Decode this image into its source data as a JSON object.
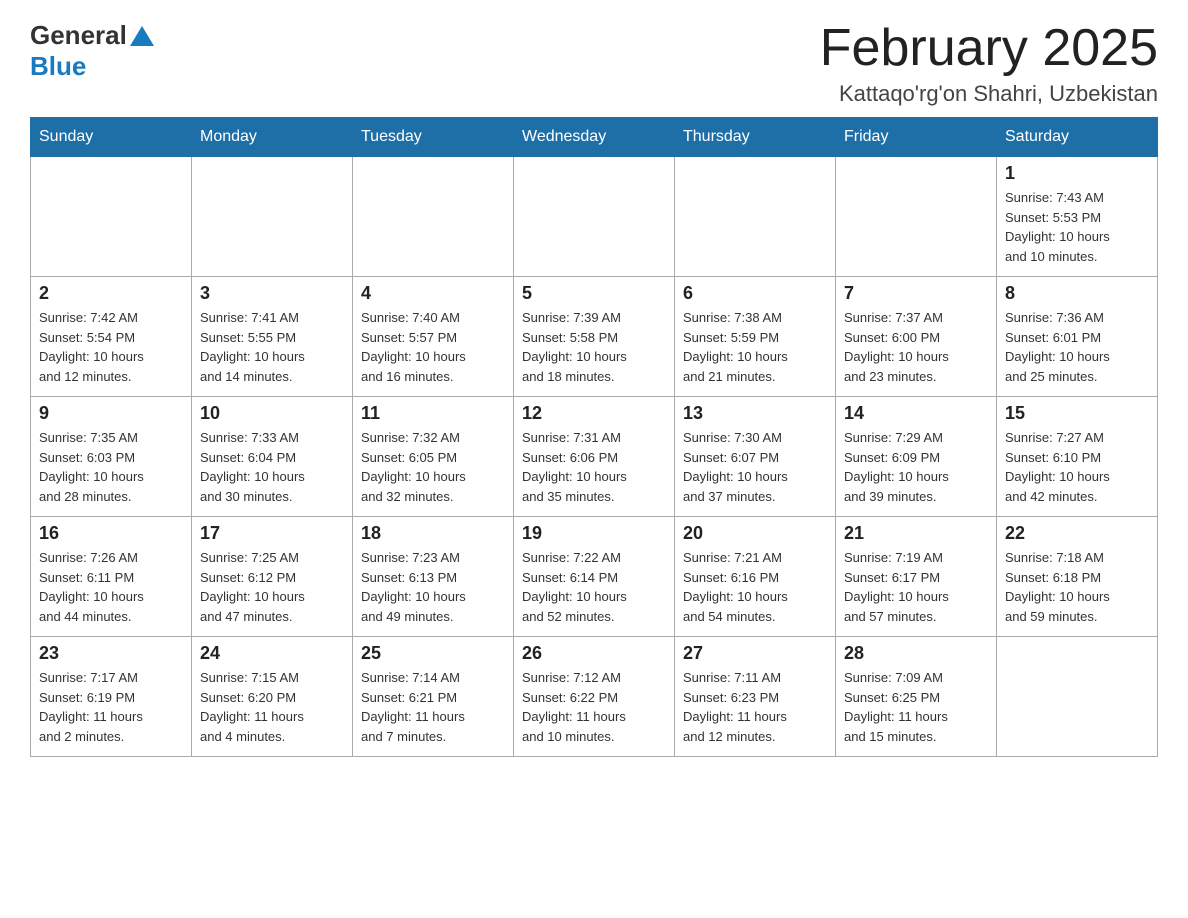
{
  "header": {
    "logo_general": "General",
    "logo_blue": "Blue",
    "month_title": "February 2025",
    "location": "Kattaqo'rg'on Shahri, Uzbekistan"
  },
  "weekdays": [
    "Sunday",
    "Monday",
    "Tuesday",
    "Wednesday",
    "Thursday",
    "Friday",
    "Saturday"
  ],
  "weeks": [
    [
      {
        "day": "",
        "info": ""
      },
      {
        "day": "",
        "info": ""
      },
      {
        "day": "",
        "info": ""
      },
      {
        "day": "",
        "info": ""
      },
      {
        "day": "",
        "info": ""
      },
      {
        "day": "",
        "info": ""
      },
      {
        "day": "1",
        "info": "Sunrise: 7:43 AM\nSunset: 5:53 PM\nDaylight: 10 hours\nand 10 minutes."
      }
    ],
    [
      {
        "day": "2",
        "info": "Sunrise: 7:42 AM\nSunset: 5:54 PM\nDaylight: 10 hours\nand 12 minutes."
      },
      {
        "day": "3",
        "info": "Sunrise: 7:41 AM\nSunset: 5:55 PM\nDaylight: 10 hours\nand 14 minutes."
      },
      {
        "day": "4",
        "info": "Sunrise: 7:40 AM\nSunset: 5:57 PM\nDaylight: 10 hours\nand 16 minutes."
      },
      {
        "day": "5",
        "info": "Sunrise: 7:39 AM\nSunset: 5:58 PM\nDaylight: 10 hours\nand 18 minutes."
      },
      {
        "day": "6",
        "info": "Sunrise: 7:38 AM\nSunset: 5:59 PM\nDaylight: 10 hours\nand 21 minutes."
      },
      {
        "day": "7",
        "info": "Sunrise: 7:37 AM\nSunset: 6:00 PM\nDaylight: 10 hours\nand 23 minutes."
      },
      {
        "day": "8",
        "info": "Sunrise: 7:36 AM\nSunset: 6:01 PM\nDaylight: 10 hours\nand 25 minutes."
      }
    ],
    [
      {
        "day": "9",
        "info": "Sunrise: 7:35 AM\nSunset: 6:03 PM\nDaylight: 10 hours\nand 28 minutes."
      },
      {
        "day": "10",
        "info": "Sunrise: 7:33 AM\nSunset: 6:04 PM\nDaylight: 10 hours\nand 30 minutes."
      },
      {
        "day": "11",
        "info": "Sunrise: 7:32 AM\nSunset: 6:05 PM\nDaylight: 10 hours\nand 32 minutes."
      },
      {
        "day": "12",
        "info": "Sunrise: 7:31 AM\nSunset: 6:06 PM\nDaylight: 10 hours\nand 35 minutes."
      },
      {
        "day": "13",
        "info": "Sunrise: 7:30 AM\nSunset: 6:07 PM\nDaylight: 10 hours\nand 37 minutes."
      },
      {
        "day": "14",
        "info": "Sunrise: 7:29 AM\nSunset: 6:09 PM\nDaylight: 10 hours\nand 39 minutes."
      },
      {
        "day": "15",
        "info": "Sunrise: 7:27 AM\nSunset: 6:10 PM\nDaylight: 10 hours\nand 42 minutes."
      }
    ],
    [
      {
        "day": "16",
        "info": "Sunrise: 7:26 AM\nSunset: 6:11 PM\nDaylight: 10 hours\nand 44 minutes."
      },
      {
        "day": "17",
        "info": "Sunrise: 7:25 AM\nSunset: 6:12 PM\nDaylight: 10 hours\nand 47 minutes."
      },
      {
        "day": "18",
        "info": "Sunrise: 7:23 AM\nSunset: 6:13 PM\nDaylight: 10 hours\nand 49 minutes."
      },
      {
        "day": "19",
        "info": "Sunrise: 7:22 AM\nSunset: 6:14 PM\nDaylight: 10 hours\nand 52 minutes."
      },
      {
        "day": "20",
        "info": "Sunrise: 7:21 AM\nSunset: 6:16 PM\nDaylight: 10 hours\nand 54 minutes."
      },
      {
        "day": "21",
        "info": "Sunrise: 7:19 AM\nSunset: 6:17 PM\nDaylight: 10 hours\nand 57 minutes."
      },
      {
        "day": "22",
        "info": "Sunrise: 7:18 AM\nSunset: 6:18 PM\nDaylight: 10 hours\nand 59 minutes."
      }
    ],
    [
      {
        "day": "23",
        "info": "Sunrise: 7:17 AM\nSunset: 6:19 PM\nDaylight: 11 hours\nand 2 minutes."
      },
      {
        "day": "24",
        "info": "Sunrise: 7:15 AM\nSunset: 6:20 PM\nDaylight: 11 hours\nand 4 minutes."
      },
      {
        "day": "25",
        "info": "Sunrise: 7:14 AM\nSunset: 6:21 PM\nDaylight: 11 hours\nand 7 minutes."
      },
      {
        "day": "26",
        "info": "Sunrise: 7:12 AM\nSunset: 6:22 PM\nDaylight: 11 hours\nand 10 minutes."
      },
      {
        "day": "27",
        "info": "Sunrise: 7:11 AM\nSunset: 6:23 PM\nDaylight: 11 hours\nand 12 minutes."
      },
      {
        "day": "28",
        "info": "Sunrise: 7:09 AM\nSunset: 6:25 PM\nDaylight: 11 hours\nand 15 minutes."
      },
      {
        "day": "",
        "info": ""
      }
    ]
  ]
}
